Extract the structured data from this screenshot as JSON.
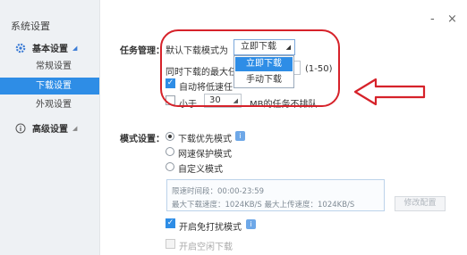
{
  "window": {
    "title": "系统设置",
    "min_label": "-",
    "close_label": "×"
  },
  "sidebar": {
    "groups": [
      {
        "label": "基本设置",
        "items": [
          "常规设置",
          "下载设置",
          "外观设置"
        ],
        "active_index": 1
      },
      {
        "label": "高级设置"
      }
    ]
  },
  "task": {
    "section_label": "任务管理：",
    "default_mode_label": "默认下载模式为",
    "dropdown": {
      "value": "立即下载",
      "options": [
        "立即下载",
        "手动下载"
      ],
      "highlighted": 0
    },
    "concurrent_label": "同时下载的最大任",
    "concurrent_range": "(1-50)",
    "auto_lowspeed_label": "自动将低速任",
    "auto_lowspeed_checked": true,
    "small_checked": false,
    "small_prefix": "小于",
    "small_value": "30",
    "small_suffix": "MB的任务不排队"
  },
  "mode": {
    "section_label": "模式设置：",
    "options": [
      "下载优先模式",
      "网速保护模式",
      "自定义模式"
    ],
    "selected": 0,
    "info": {
      "time_range": "限速时间段：00:00-23:59",
      "limits": "最大下载速度：1024KB/S  最大上传速度：1024KB/S"
    },
    "edit_button": "修改配置",
    "free_mode_label": "开启免打扰模式",
    "free_mode_checked": true,
    "idle_label": "开启空闲下载",
    "idle_checked": false
  },
  "colors": {
    "accent": "#2e8de6",
    "annotation": "#d6222a"
  },
  "icons": [
    "gear-icon",
    "info-icon",
    "chevron-down-icon",
    "close-icon",
    "minimize-icon",
    "arrow-left-icon"
  ]
}
